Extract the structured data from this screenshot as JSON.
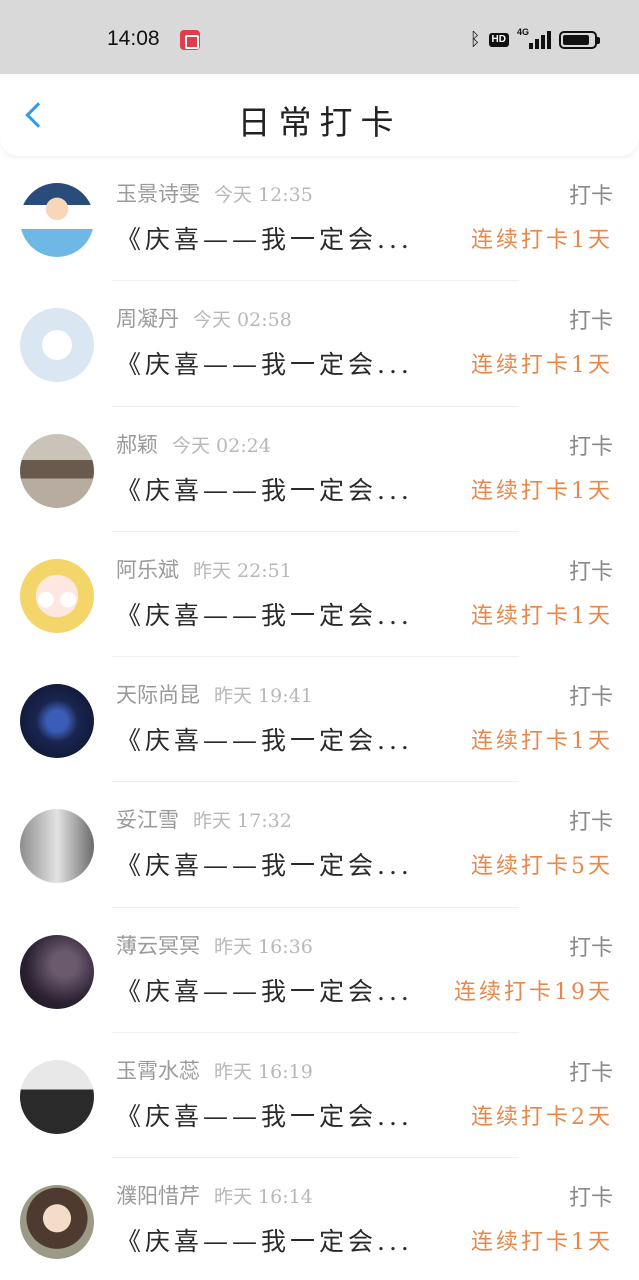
{
  "status_bar": {
    "time": "14:08",
    "app_icon": "screen-record-icon",
    "icons": [
      "bluetooth-icon",
      "hd-icon",
      "4g-signal-icon",
      "battery-icon"
    ],
    "hd_label": "HD",
    "network_label": "4G",
    "battery_level": 0.8
  },
  "header": {
    "back_icon": "chevron-left-icon",
    "title": "日常打卡",
    "accent_color": "#2f9be8"
  },
  "colors": {
    "streak": "#e8874a",
    "name": "#9a9a9a",
    "content": "#2a2a2a"
  },
  "entries": [
    {
      "name": "玉景诗雯",
      "time": "今天 12:35",
      "action": "打卡",
      "content": "《庆喜——我一定会...",
      "streak": "连续打卡1天",
      "avatar": "cartoon-official-avatar"
    },
    {
      "name": "周凝丹",
      "time": "今天 02:58",
      "action": "打卡",
      "content": "《庆喜——我一定会...",
      "streak": "连续打卡1天",
      "avatar": "default-avatar"
    },
    {
      "name": "郝颖",
      "time": "今天 02:24",
      "action": "打卡",
      "content": "《庆喜——我一定会...",
      "streak": "连续打卡1天",
      "avatar": "photo-avatar"
    },
    {
      "name": "阿乐斌",
      "time": "昨天 22:51",
      "action": "打卡",
      "content": "《庆喜——我一定会...",
      "streak": "连续打卡1天",
      "avatar": "anime-avatar"
    },
    {
      "name": "天际尚昆",
      "time": "昨天 19:41",
      "action": "打卡",
      "content": "《庆喜——我一定会...",
      "streak": "连续打卡1天",
      "avatar": "logo-avatar"
    },
    {
      "name": "妥江雪",
      "time": "昨天 17:32",
      "action": "打卡",
      "content": "《庆喜——我一定会...",
      "streak": "连续打卡5天",
      "avatar": "bw-photo-avatar"
    },
    {
      "name": "薄云冥冥",
      "time": "昨天 16:36",
      "action": "打卡",
      "content": "《庆喜——我一定会...",
      "streak": "连续打卡19天",
      "avatar": "dark-photo-avatar"
    },
    {
      "name": "玉霄水蕊",
      "time": "昨天 16:19",
      "action": "打卡",
      "content": "《庆喜——我一定会...",
      "streak": "连续打卡2天",
      "avatar": "bw-photo-avatar-2"
    },
    {
      "name": "濮阳惜芹",
      "time": "昨天 16:14",
      "action": "打卡",
      "content": "《庆喜——我一定会...",
      "streak": "连续打卡1天",
      "avatar": "portrait-avatar"
    }
  ]
}
